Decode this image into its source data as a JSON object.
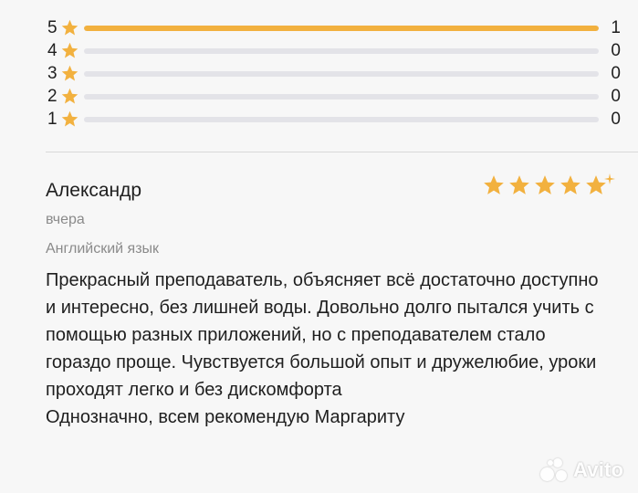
{
  "ratings_breakdown": [
    {
      "stars": "5",
      "count": "1",
      "fill_fraction": 1.0
    },
    {
      "stars": "4",
      "count": "0",
      "fill_fraction": 0.0
    },
    {
      "stars": "3",
      "count": "0",
      "fill_fraction": 0.0
    },
    {
      "stars": "2",
      "count": "0",
      "fill_fraction": 0.0
    },
    {
      "stars": "1",
      "count": "0",
      "fill_fraction": 0.0
    }
  ],
  "review": {
    "author": "Александр",
    "date": "вчера",
    "subject": "Английский язык",
    "rating": 5,
    "text_paragraphs": [
      "Прекрасный преподаватель, объясняет всё достаточно доступно и интересно, без лишней воды. Довольно долго пытался учить с помощью разных приложений, но с преподавателем стало гораздо проще. Чувствуется большой опыт и дружелюбие, уроки проходят легко и без дискомфорта",
      "Однозначно, всем рекомендую Маргариту"
    ]
  },
  "watermark": {
    "text": "Avito"
  },
  "colors": {
    "accent_star": "#f2b13f",
    "track": "#e3e3e8",
    "text": "#1f1f1f",
    "muted": "#8a8a8a"
  },
  "icons": {
    "star": "star-icon",
    "sparkle": "sparkle-icon"
  }
}
